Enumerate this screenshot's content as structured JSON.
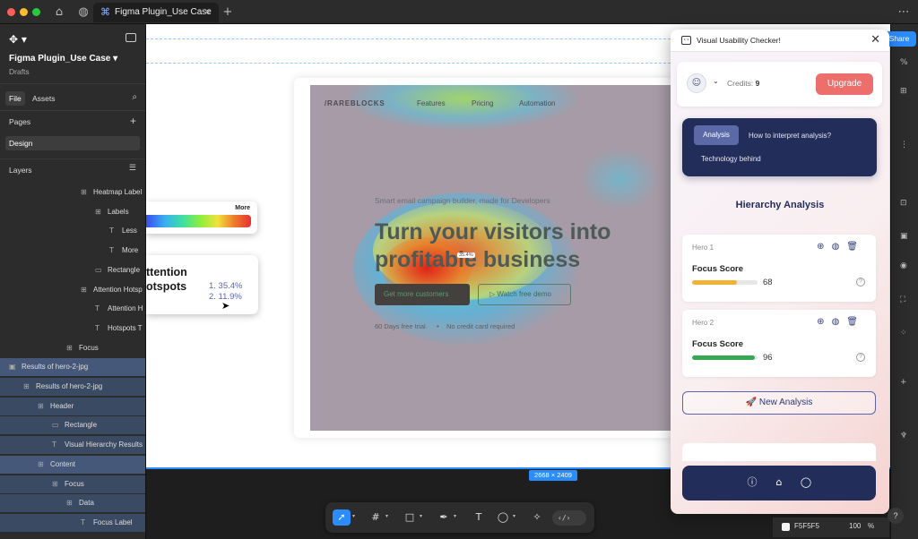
{
  "tabbar": {
    "file_tab": "Figma Plugin_Use Case",
    "close": "✕",
    "new_tab": "+",
    "more": "⋯"
  },
  "left_panel": {
    "file_name": "Figma Plugin_Use Case",
    "location": "Drafts",
    "tabs": [
      "File",
      "Assets"
    ],
    "pages_label": "Pages",
    "page": "Design",
    "layers_label": "Layers",
    "layers": [
      {
        "label": "Heatmap Label",
        "indent": 5,
        "icon": "frame"
      },
      {
        "label": "Labels",
        "indent": 6,
        "icon": "frame"
      },
      {
        "label": "Less",
        "indent": 7,
        "icon": "text"
      },
      {
        "label": "More",
        "indent": 7,
        "icon": "text"
      },
      {
        "label": "Rectangle",
        "indent": 6,
        "icon": "rect"
      },
      {
        "label": "Attention Hotsp",
        "indent": 5,
        "icon": "frame"
      },
      {
        "label": "Attention H",
        "indent": 6,
        "icon": "text"
      },
      {
        "label": "Hotspots T",
        "indent": 6,
        "icon": "text"
      },
      {
        "label": "Focus",
        "indent": 4,
        "icon": "frame"
      },
      {
        "label": "Results of hero-2-jpg",
        "indent": 0,
        "icon": "component",
        "sel": "strong"
      },
      {
        "label": "Results of hero-2-jpg",
        "indent": 1,
        "icon": "frame",
        "sel": "light"
      },
      {
        "label": "Header",
        "indent": 2,
        "icon": "frame",
        "sel": "light"
      },
      {
        "label": "Rectangle",
        "indent": 3,
        "icon": "rect",
        "sel": "light"
      },
      {
        "label": "Visual Hierarchy Results",
        "indent": 3,
        "icon": "text",
        "sel": "light"
      },
      {
        "label": "Content",
        "indent": 2,
        "icon": "frame",
        "sel": "strong"
      },
      {
        "label": "Focus",
        "indent": 3,
        "icon": "frame",
        "sel": "light"
      },
      {
        "label": "Data",
        "indent": 4,
        "icon": "frame",
        "sel": "light"
      },
      {
        "label": "Focus Label",
        "indent": 5,
        "icon": "text",
        "sel": "light"
      }
    ]
  },
  "canvas": {
    "size_badge": "2668 × 2409",
    "legend_more": "More",
    "hotspots_title_1": "ttention",
    "hotspots_title_2": "otspots",
    "hotspot_1": "1. 35.4%",
    "hotspot_2": "2. 11.9%",
    "heat_pct": "35.4%"
  },
  "site": {
    "brand": "/RAREBLOCKS",
    "nav": [
      "Features",
      "Pricing",
      "Automation"
    ],
    "tagline": "Smart email campaign builder, made for Developers",
    "headline_1": "Turn your visitors into",
    "headline_2": "profitable business",
    "cta_primary": "Get more customers",
    "cta_secondary": "Watch free demo",
    "fine_1": "60 Days free trial",
    "fine_2": "No credit card required"
  },
  "plugin": {
    "title": "Visual Usability Checker!",
    "credits_label": "Credits:",
    "credits_value": "9",
    "upgrade": "Upgrade",
    "tabs": [
      "Analysis",
      "How to interpret analysis?",
      "Technology behind"
    ],
    "section_title": "Hierarchy Analysis",
    "heroes": [
      {
        "name": "Hero 1",
        "focus_label": "Focus Score",
        "score": 68,
        "color": "#f0b232"
      },
      {
        "name": "Hero 2",
        "focus_label": "Focus Score",
        "score": 96,
        "color": "#36a852"
      }
    ],
    "new_analysis": "New Analysis"
  },
  "right_panel": {
    "share": "Share"
  },
  "status": {
    "fill_hex": "F5F5F5",
    "opacity": "100",
    "unit": "%",
    "help": "?"
  }
}
